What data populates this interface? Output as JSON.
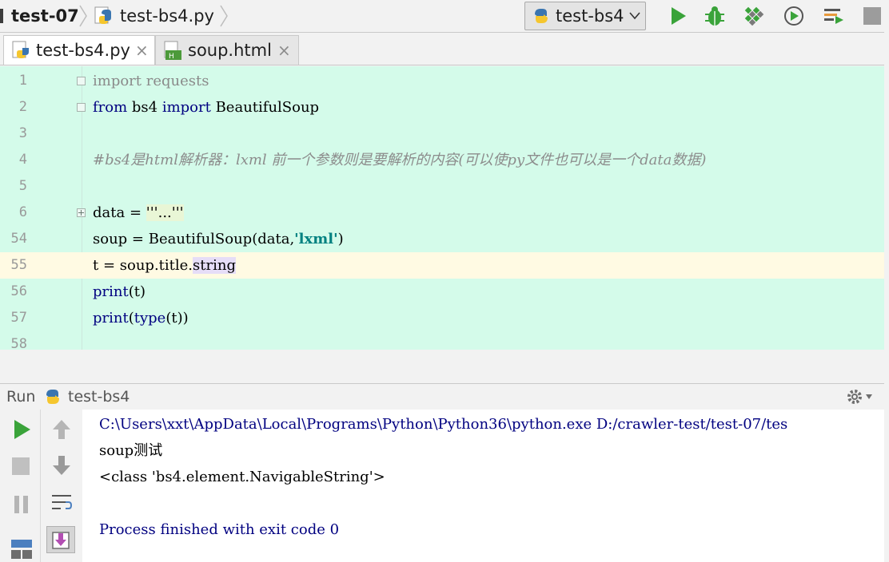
{
  "navbar": {
    "project": "test-07",
    "file": "test-bs4.py",
    "run_config": "test-bs4",
    "icons": [
      "run-icon",
      "debug-icon",
      "coverage-icon",
      "profile-icon",
      "build-icon",
      "stop-icon"
    ]
  },
  "tabs": [
    {
      "label": "test-bs4.py",
      "close": "×",
      "active": true
    },
    {
      "label": "soup.html",
      "close": "×",
      "active": false
    }
  ],
  "editor": {
    "lines": [
      {
        "num": "1",
        "parts": [
          {
            "t": "import",
            "c": "kw-gray"
          },
          {
            "t": " requests",
            "c": "kw-gray"
          }
        ]
      },
      {
        "num": "2",
        "parts": [
          {
            "t": "from",
            "c": "kw"
          },
          {
            "t": " bs4 ",
            "c": ""
          },
          {
            "t": "import",
            "c": "kw"
          },
          {
            "t": " BeautifulSoup",
            "c": ""
          }
        ]
      },
      {
        "num": "3",
        "parts": []
      },
      {
        "num": "4",
        "parts": [
          {
            "t": "#bs4是html解析器：lxml 前一个参数则是要解析的内容(可以使py文件也可以是一个data数据)",
            "c": "comment"
          }
        ]
      },
      {
        "num": "5",
        "parts": []
      },
      {
        "num": "6",
        "parts": [
          {
            "t": "data = ",
            "c": ""
          },
          {
            "t": "'''...'''",
            "c": "quote-bg"
          }
        ]
      },
      {
        "num": "54",
        "parts": [
          {
            "t": "soup = BeautifulSoup(data,",
            "c": ""
          },
          {
            "t": "'lxml'",
            "c": "str"
          },
          {
            "t": ")",
            "c": ""
          }
        ]
      },
      {
        "num": "55",
        "parts": [
          {
            "t": "t = soup.title.",
            "c": ""
          },
          {
            "t": "string",
            "c": "sel-word"
          }
        ]
      },
      {
        "num": "56",
        "parts": [
          {
            "t": "print",
            "c": "kw"
          },
          {
            "t": "(t)",
            "c": ""
          }
        ]
      },
      {
        "num": "57",
        "parts": [
          {
            "t": "print",
            "c": "kw"
          },
          {
            "t": "(",
            "c": ""
          },
          {
            "t": "type",
            "c": "kw"
          },
          {
            "t": "(t))",
            "c": ""
          }
        ]
      },
      {
        "num": "58",
        "parts": []
      }
    ]
  },
  "run_panel": {
    "title": "Run",
    "config": "test-bs4",
    "output": [
      {
        "text": "C:\\Users\\xxt\\AppData\\Local\\Programs\\Python\\Python36\\python.exe D:/crawler-test/test-07/tes",
        "color": "#000080"
      },
      {
        "text": "soup测试",
        "color": "#000000"
      },
      {
        "text": "<class 'bs4.element.NavigableString'>",
        "color": "#000000"
      },
      {
        "text": "",
        "color": "#000000"
      },
      {
        "text": "Process finished with exit code 0",
        "color": "#000080"
      }
    ]
  }
}
